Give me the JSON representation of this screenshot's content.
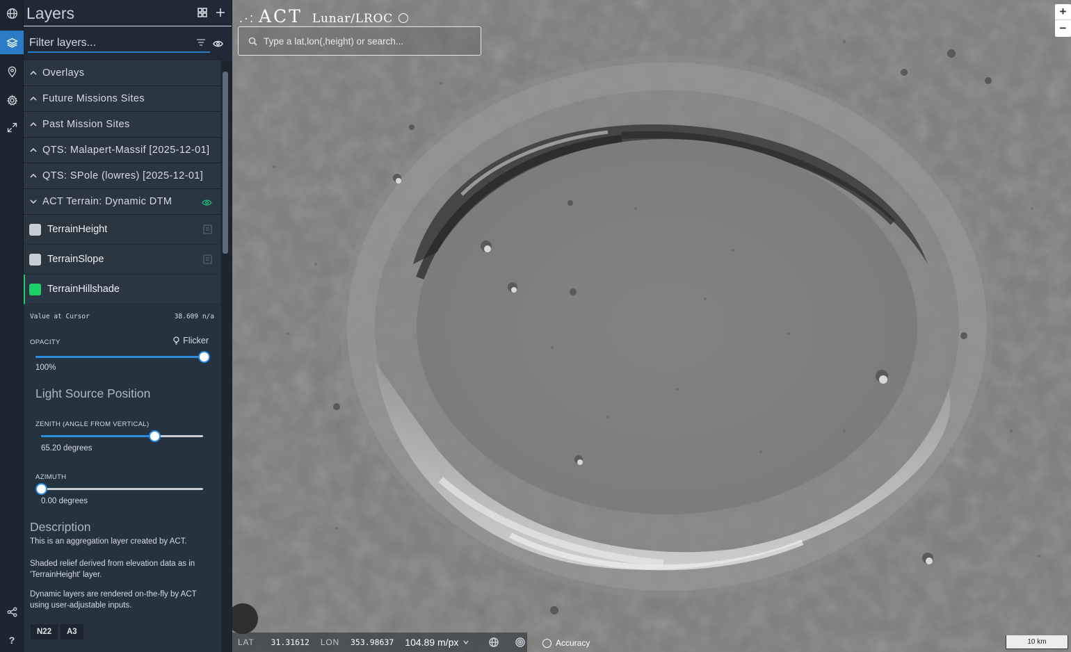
{
  "panel": {
    "title": "Layers",
    "filter_placeholder": "Filter layers..."
  },
  "groups": [
    {
      "label": "Overlays"
    },
    {
      "label": "Future Missions Sites"
    },
    {
      "label": "Past Mission Sites"
    },
    {
      "label": "QTS: Malapert-Massif [2025-12-01]"
    },
    {
      "label": "QTS: SPole (lowres) [2025-12-01]"
    },
    {
      "label": "ACT Terrain: Dynamic DTM"
    }
  ],
  "sublayers": [
    {
      "label": "TerrainHeight",
      "checked": false
    },
    {
      "label": "TerrainSlope",
      "checked": false
    },
    {
      "label": "TerrainHillshade",
      "checked": true
    }
  ],
  "settings": {
    "value_at_cursor_label": "Value at Cursor",
    "value_at_cursor": "38.609 n/a",
    "opacity_label": "OPACITY",
    "flicker_label": "Flicker",
    "opacity_value": "100%",
    "opacity_fraction": 1.0,
    "light_source_title": "Light Source Position",
    "zenith_label": "ZENITH (ANGLE FROM VERTICAL)",
    "zenith_value": "65.20 degrees",
    "zenith_fraction": 0.7,
    "azimuth_label": "AZIMUTH",
    "azimuth_value": "0.00 degrees",
    "azimuth_fraction": 0.0
  },
  "description": {
    "title": "Description",
    "p1": "This is an aggregation layer created by ACT.",
    "p2": "Shaded relief derived from elevation data as in 'TerrainHeight' layer.",
    "p3": "Dynamic layers are rendered on-the-fly by ACT using user-adjustable inputs.",
    "tags": [
      "N22",
      "A3"
    ]
  },
  "map": {
    "brand_dots": ".·:",
    "brand_name": "ACT",
    "mission": "Lunar/LROC",
    "search_placeholder": "Type a lat,lon(,height) or search...",
    "zoom_in": "+",
    "zoom_out": "−",
    "lat_label": "LAT",
    "lat_value": "31.31612",
    "lon_label": "LON",
    "lon_value": "353.98637",
    "scale_value": "104.89 m/px",
    "accuracy_label": "Accuracy",
    "scalebar_label": "10 km"
  },
  "colors": {
    "accent": "#2b7bc7",
    "active_green": "#1bd067",
    "eye_green": "#1aaf6e"
  }
}
